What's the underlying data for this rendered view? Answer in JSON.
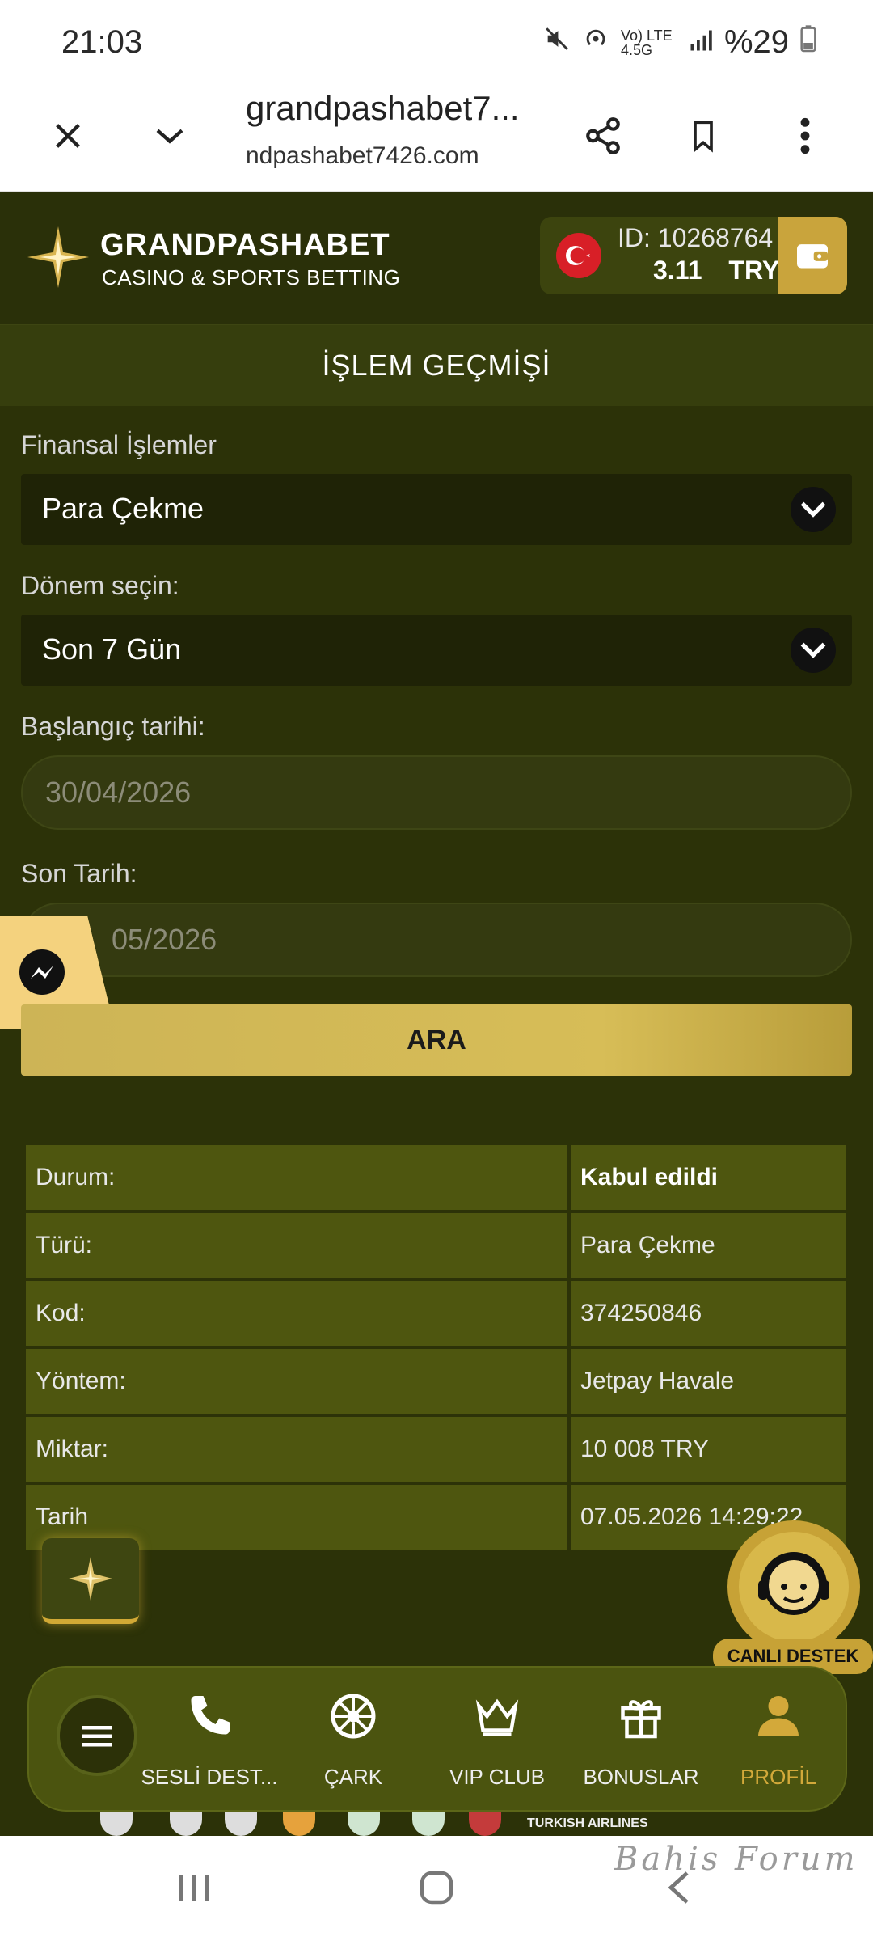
{
  "status_bar": {
    "time": "21:03",
    "network": "Vo) LTE 4.5G",
    "battery": "%29"
  },
  "browser": {
    "title": "grandpashabet7...",
    "url": "ndpashabet7426.com",
    "icons": [
      "close-icon",
      "chevron-down-icon",
      "share-icon",
      "bookmark-icon",
      "more-vert-icon"
    ]
  },
  "header": {
    "brand": "GRANDPASHABET",
    "tagline": "CASINO & SPORTS BETTING",
    "account_id": "ID: 10268764",
    "balance": "3.11",
    "currency": "TRY"
  },
  "page_title": "İŞLEM GEÇMİŞİ",
  "form": {
    "type_label": "Finansal İşlemler",
    "type_value": "Para Çekme",
    "period_label": "Dönem seçin:",
    "period_value": "Son 7 Gün",
    "start_label": "Başlangıç tarihi:",
    "start_value": "30/04/2026",
    "end_label": "Son Tarih:",
    "end_value": "05/2026",
    "search_button": "ARA"
  },
  "details": [
    {
      "key": "Durum:",
      "value": "Kabul edildi"
    },
    {
      "key": "Türü:",
      "value": "Para Çekme"
    },
    {
      "key": "Kod:",
      "value": "374250846"
    },
    {
      "key": "Yöntem:",
      "value": "Jetpay Havale"
    },
    {
      "key": "Miktar:",
      "value": "10 008 TRY"
    },
    {
      "key": "Tarih",
      "value": "07.05.2026 14:29:22"
    }
  ],
  "live_support": "CANLI DESTEK",
  "bottom_nav": [
    {
      "label": "SESLİ DEST...",
      "icon": "phone-icon"
    },
    {
      "label": "ÇARK",
      "icon": "wheel-icon"
    },
    {
      "label": "VIP CLUB",
      "icon": "crown-icon"
    },
    {
      "label": "BONUSLAR",
      "icon": "gift-icon"
    },
    {
      "label": "PROFİL",
      "icon": "user-icon"
    }
  ],
  "sponsor_text": "TURKISH AIRLINES",
  "watermark": "Bahis Forum",
  "colors": {
    "accent_gold": "#d3a93a",
    "bg": "#2c3208",
    "panel": "#4e560f"
  }
}
